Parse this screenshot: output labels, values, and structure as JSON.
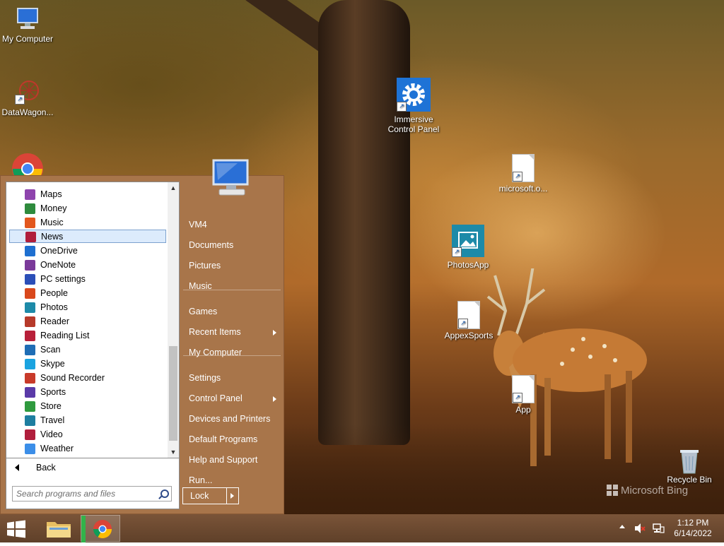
{
  "desktop_icons": [
    {
      "label": "My Computer",
      "icon": "computer-icon"
    },
    {
      "label": "DataWagon...",
      "icon": "datawagon-icon"
    },
    {
      "label": "Immersive Control Panel",
      "icon": "gear-icon"
    },
    {
      "label": "microsoft.o...",
      "icon": "file-icon"
    },
    {
      "label": "PhotosApp",
      "icon": "photos-icon"
    },
    {
      "label": "AppexSports",
      "icon": "file-icon"
    },
    {
      "label": "App",
      "icon": "file-icon"
    },
    {
      "label": "Recycle Bin",
      "icon": "recycle-bin-icon"
    }
  ],
  "wallpaper": {
    "watermark": "Microsoft Bing"
  },
  "start_menu": {
    "programs": [
      {
        "label": "Maps",
        "color": "#8e44ad"
      },
      {
        "label": "Money",
        "color": "#2e8b3d"
      },
      {
        "label": "Music",
        "color": "#e2571e"
      },
      {
        "label": "News",
        "color": "#b01e3c",
        "selected": true
      },
      {
        "label": "OneDrive",
        "color": "#1e6fd0"
      },
      {
        "label": "OneNote",
        "color": "#7a3a9a"
      },
      {
        "label": "PC settings",
        "color": "#2b4fb8"
      },
      {
        "label": "People",
        "color": "#d9481c"
      },
      {
        "label": "Photos",
        "color": "#1d8aa8"
      },
      {
        "label": "Reader",
        "color": "#b63a2a"
      },
      {
        "label": "Reading List",
        "color": "#b8203a"
      },
      {
        "label": "Scan",
        "color": "#1f6db5"
      },
      {
        "label": "Skype",
        "color": "#1aa3e0"
      },
      {
        "label": "Sound Recorder",
        "color": "#c83a2a"
      },
      {
        "label": "Sports",
        "color": "#5a3aa8"
      },
      {
        "label": "Store",
        "color": "#2f9a3e"
      },
      {
        "label": "Travel",
        "color": "#1e7ea0"
      },
      {
        "label": "Video",
        "color": "#b01e3c"
      },
      {
        "label": "Weather",
        "color": "#3b8ee8"
      }
    ],
    "back_label": "Back",
    "search_placeholder": "Search programs and files",
    "right_links": [
      {
        "label": "VM4"
      },
      {
        "label": "Documents"
      },
      {
        "label": "Pictures"
      },
      {
        "label": "Music"
      },
      {
        "label": "Games"
      },
      {
        "label": "Recent Items",
        "submenu": true
      },
      {
        "label": "My Computer"
      },
      {
        "label": "Settings"
      },
      {
        "label": "Control Panel",
        "submenu": true
      },
      {
        "label": "Devices and Printers"
      },
      {
        "label": "Default Programs"
      },
      {
        "label": "Help and Support"
      },
      {
        "label": "Run..."
      }
    ],
    "lock_label": "Lock"
  },
  "taskbar": {
    "clock_time": "1:12 PM",
    "clock_date": "6/14/2022"
  }
}
